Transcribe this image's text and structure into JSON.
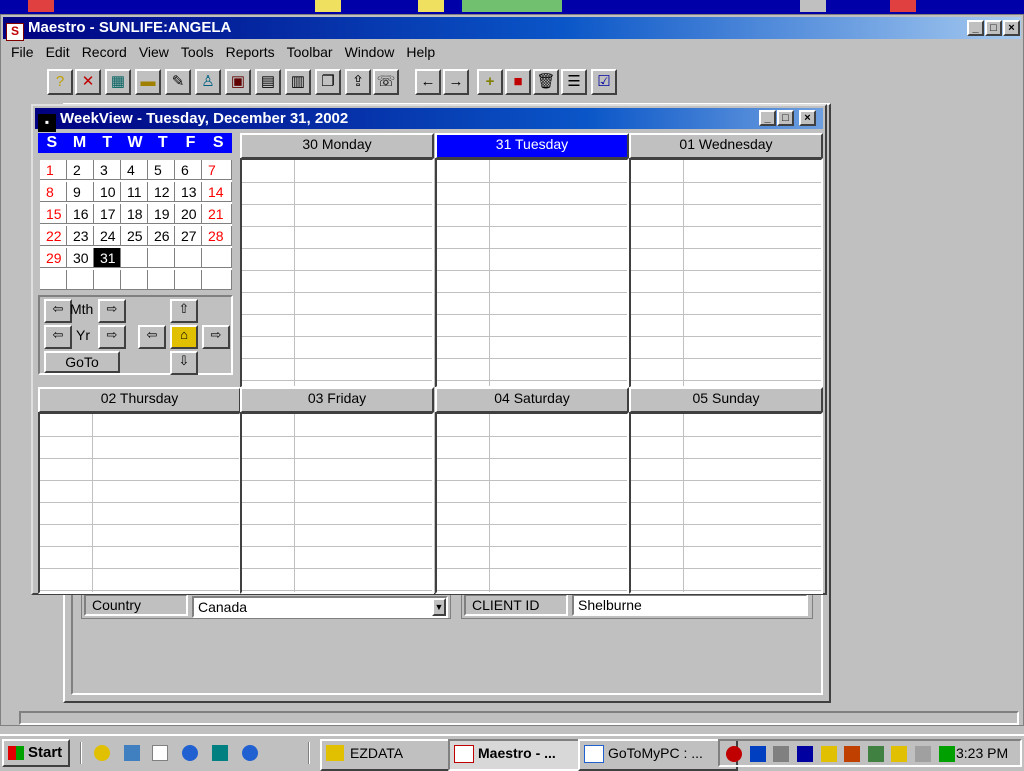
{
  "main_window": {
    "title": "Maestro - SUNLIFE:ANGELA",
    "min": "_",
    "max": "□",
    "close": "×"
  },
  "menu": [
    "File",
    "Edit",
    "Record",
    "View",
    "Tools",
    "Reports",
    "Toolbar",
    "Window",
    "Help"
  ],
  "toolbar": [
    {
      "name": "help-icon",
      "glyph": "?"
    },
    {
      "name": "cancel-icon",
      "glyph": "✕"
    },
    {
      "name": "calculator-icon",
      "glyph": "▦"
    },
    {
      "name": "minus-icon",
      "glyph": "▬"
    },
    {
      "name": "tools-icon",
      "glyph": "✎"
    },
    {
      "name": "people-icon",
      "glyph": "♙"
    },
    {
      "name": "book-icon",
      "glyph": "▣"
    },
    {
      "name": "calendar-icon",
      "glyph": "▤"
    },
    {
      "name": "calendar2-icon",
      "glyph": "▥"
    },
    {
      "name": "copy-icon",
      "glyph": "❐"
    },
    {
      "name": "export-icon",
      "glyph": "⇪"
    },
    {
      "name": "phone-icon",
      "glyph": "☏"
    },
    {
      "name": "back-arrow-icon",
      "glyph": "←"
    },
    {
      "name": "forward-arrow-icon",
      "glyph": "→"
    },
    {
      "name": "add-icon",
      "glyph": "+"
    },
    {
      "name": "color-icon",
      "glyph": "■"
    },
    {
      "name": "trash-icon",
      "glyph": "🗑"
    },
    {
      "name": "list-icon",
      "glyph": "☰"
    },
    {
      "name": "check-icon",
      "glyph": "☑"
    }
  ],
  "weekview": {
    "title": "WeekView - Tuesday, December 31, 2002",
    "dow": [
      "S",
      "M",
      "T",
      "W",
      "T",
      "F",
      "S"
    ],
    "calendar_rows": [
      [
        "1",
        "2",
        "3",
        "4",
        "5",
        "6",
        "7"
      ],
      [
        "8",
        "9",
        "10",
        "11",
        "12",
        "13",
        "14"
      ],
      [
        "15",
        "16",
        "17",
        "18",
        "19",
        "20",
        "21"
      ],
      [
        "22",
        "23",
        "24",
        "25",
        "26",
        "27",
        "28"
      ],
      [
        "29",
        "30",
        "31",
        "",
        "",
        "",
        ""
      ],
      [
        "",
        "",
        "",
        "",
        "",
        "",
        ""
      ]
    ],
    "nav": {
      "month_label": "Mth",
      "year_label": "Yr",
      "goto_label": "GoTo"
    },
    "days_top": [
      "30 Monday",
      "31 Tuesday",
      "01 Wednesday"
    ],
    "days_bottom": [
      "02 Thursday",
      "03 Friday",
      "04 Saturday",
      "05 Sunday"
    ],
    "selected_day": "31 Tuesday"
  },
  "form": {
    "country_label": "Country",
    "country_value": "Canada",
    "client_id_label": "CLIENT ID",
    "client_id_value": "Shelburne"
  },
  "taskbar": {
    "start": "Start",
    "tasks": [
      "EZDATA",
      "Maestro - ...",
      "GoToMyPC : ..."
    ],
    "clock": "3:23 PM"
  }
}
